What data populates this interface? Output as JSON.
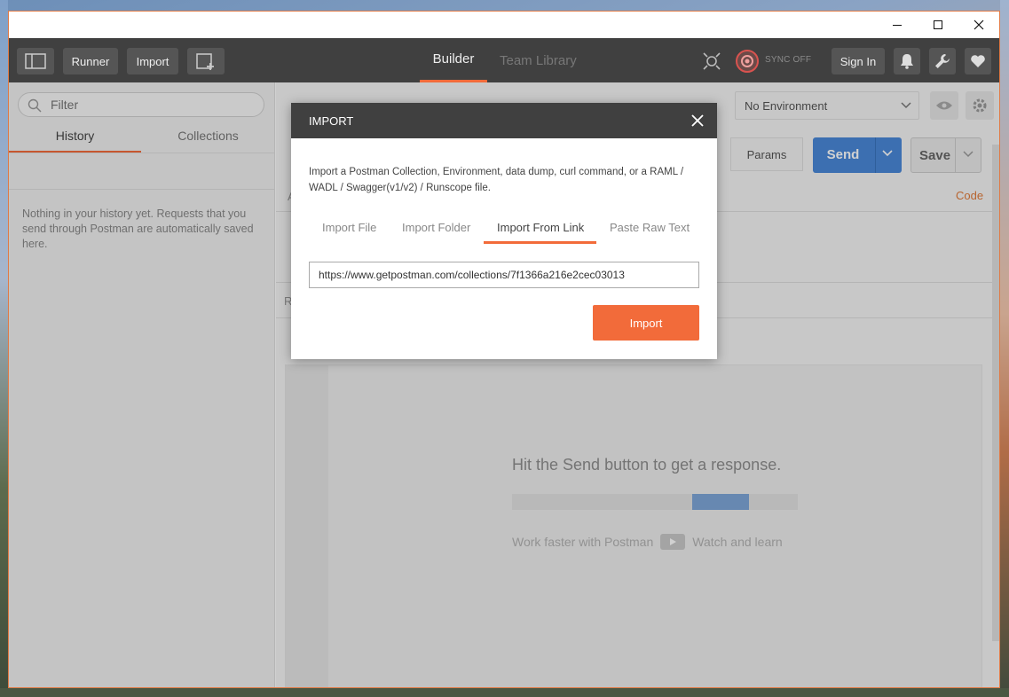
{
  "titlebar": {
    "minimize_icon": "minimize-icon",
    "maximize_icon": "maximize-icon",
    "close_icon": "close-icon"
  },
  "toolbar": {
    "runner_label": "Runner",
    "import_label": "Import",
    "builder_label": "Builder",
    "team_library_label": "Team Library",
    "sync_label": "SYNC OFF",
    "sign_in_label": "Sign In",
    "accent": "#f26b3a"
  },
  "sidebar": {
    "filter_placeholder": "Filter",
    "tabs": [
      {
        "label": "History"
      },
      {
        "label": "Collections"
      }
    ],
    "empty_text": "Nothing in your history yet. Requests that you send through Postman are automatically saved here."
  },
  "main": {
    "environment": "No Environment",
    "params_label": "Params",
    "send_label": "Send",
    "save_label": "Save",
    "code_label": "Code",
    "tab_a": "A",
    "tab_r": "R",
    "response_hint": "Hit the Send button to get a response.",
    "work_faster": "Work faster with Postman",
    "watch_learn": "Watch and learn",
    "send_color": "#4a88d8"
  },
  "modal": {
    "title": "IMPORT",
    "description": "Import a Postman Collection, Environment, data dump, curl command, or a RAML / WADL / Swagger(v1/v2) / Runscope file.",
    "tabs": [
      {
        "label": "Import File"
      },
      {
        "label": "Import Folder"
      },
      {
        "label": "Import From Link"
      },
      {
        "label": "Paste Raw Text"
      }
    ],
    "active_tab": "Import From Link",
    "url_value": "https://www.getpostman.com/collections/7f1366a216e2cec03013",
    "import_button": "Import"
  }
}
